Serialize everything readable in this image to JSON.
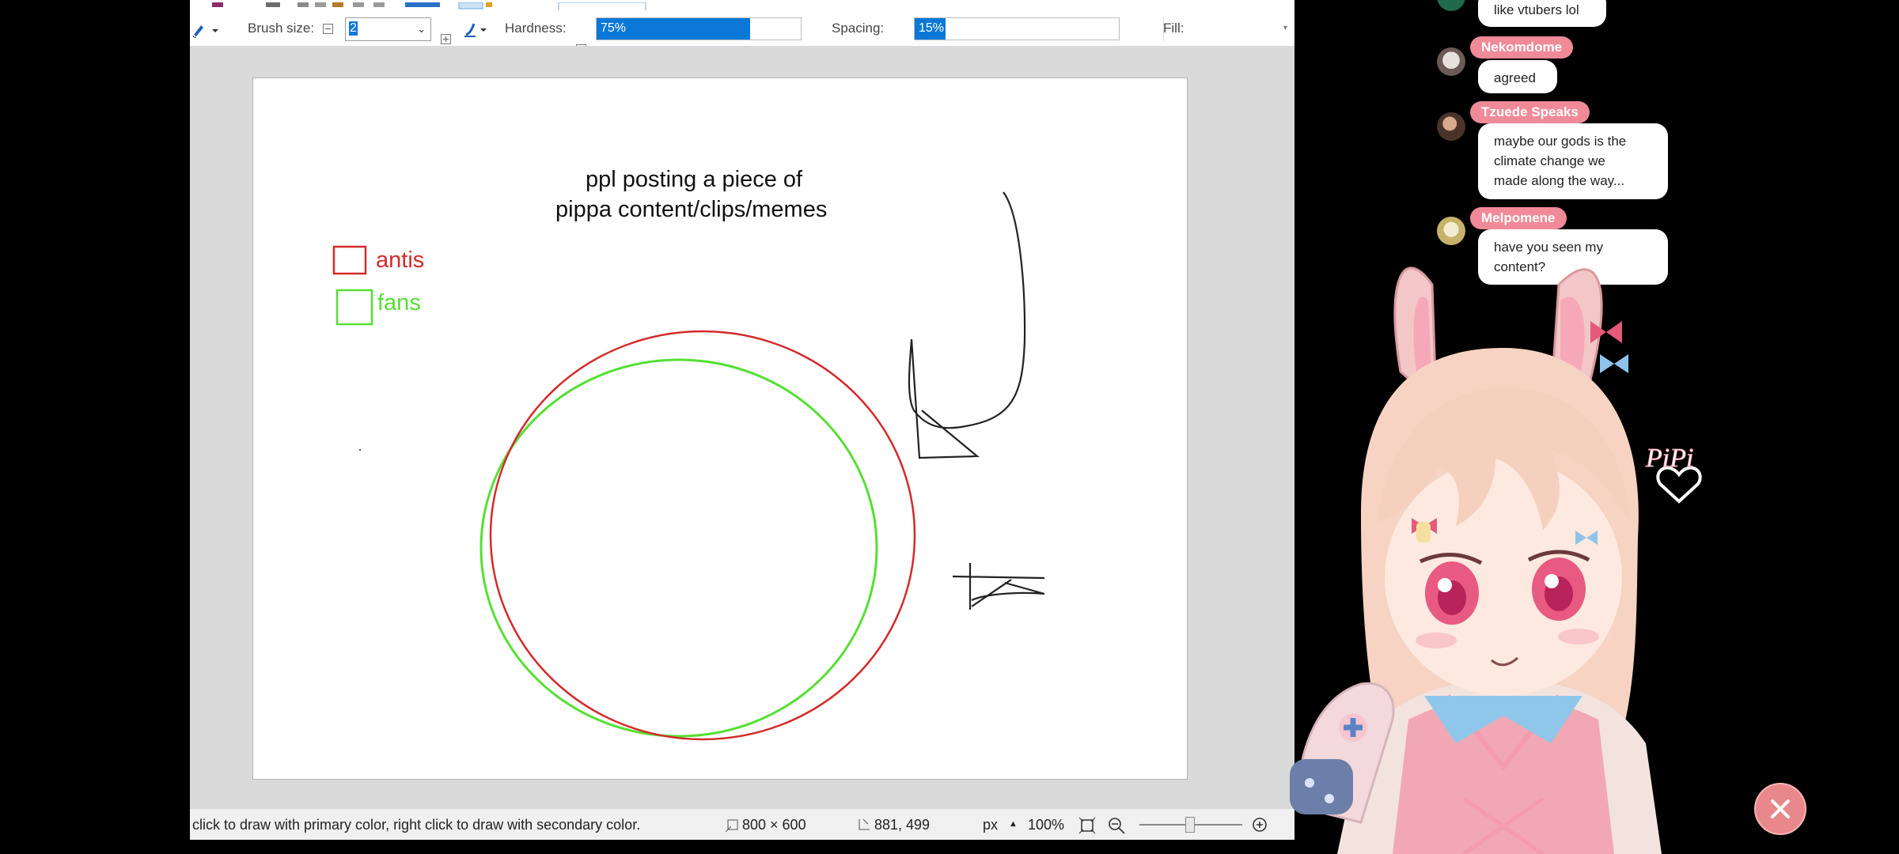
{
  "toolbar": {
    "brush_size_label": "Brush size:",
    "brush_size_value": "2",
    "hardness_label": "Hardness:",
    "hardness_value": "75%",
    "hardness_fraction": 0.75,
    "spacing_label": "Spacing:",
    "spacing_value": "15%",
    "spacing_fraction": 0.15,
    "fill_label": "Fill:"
  },
  "canvas": {
    "title_line1": "ppl posting a piece of",
    "title_line2": "pippa content/clips/memes",
    "legend_antis": "antis",
    "legend_fans": "fans",
    "antis_color": "#d42a2a",
    "fans_color": "#55e033"
  },
  "statusbar": {
    "hint": "click to draw with primary color, right click to draw with secondary color.",
    "image_size": "800 × 600",
    "cursor_pos": "881, 499",
    "unit": "px",
    "zoom": "100%"
  },
  "chat": [
    {
      "name": "",
      "text_lines": [
        "like vtubers lol"
      ]
    },
    {
      "name": "Nekomdome",
      "text_lines": [
        "agreed"
      ]
    },
    {
      "name": "Tzuede Speaks",
      "text_lines": [
        "maybe our gods is the",
        "climate change we",
        "made along the way..."
      ]
    },
    {
      "name": "Melpomene",
      "text_lines": [
        "have you seen my",
        "content?"
      ]
    }
  ],
  "overlay": {
    "logo_text": "PiPi",
    "name_tag_color": "#f08a98",
    "close_color": "#e9888c"
  }
}
